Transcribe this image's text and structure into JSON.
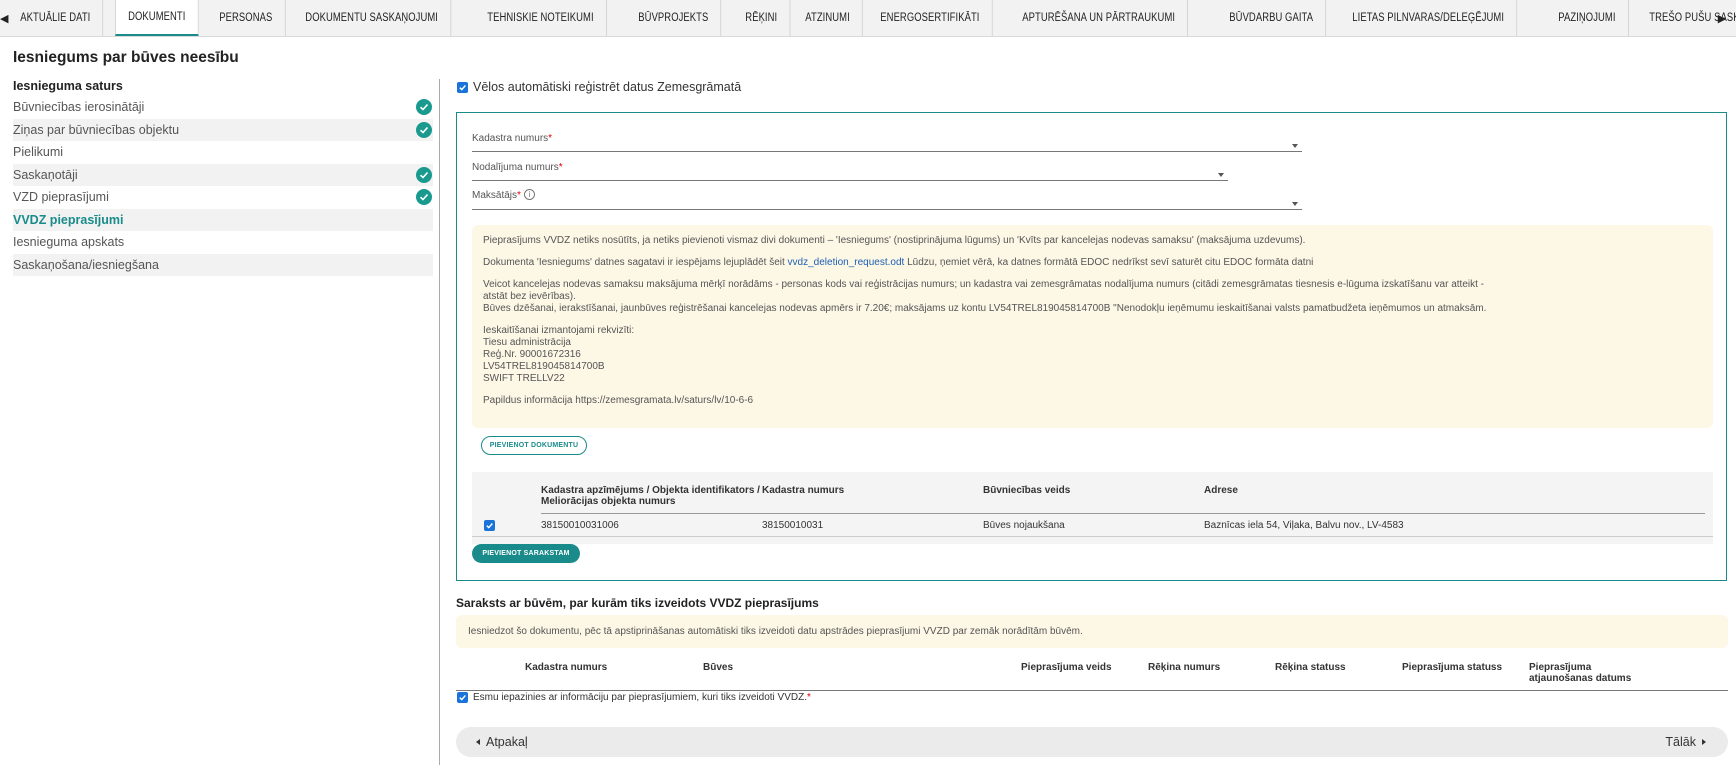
{
  "tabs": {
    "left_arrow": "◀",
    "right_arrow": "▶",
    "items": [
      "AKTUĀLIE DATI",
      "DOKUMENTI",
      "PERSONAS",
      "DOKUMENTU SASKAŅOJUMI",
      "TEHNISKIE NOTEIKUMI",
      "BŪVPROJEKTS",
      "RĒĶINI",
      "ATZINUMI",
      "ENERGOSERTIFIKĀTI",
      "APTURĒŠANA UN PĀRTRAUKUMI",
      "BŪVDARBU GAITA",
      "LIETAS PILNVARAS/DELEĢĒJUMI",
      "PAZIŅOJUMI",
      "TREŠO PUŠU SASKAŅOJUMI"
    ],
    "active_index": 1
  },
  "page_title": "Iesniegums par būves neesību",
  "leftnav": {
    "heading": "Iesnieguma saturs",
    "items": [
      {
        "label": "Būvniecības ierosinātāji",
        "completed": true
      },
      {
        "label": "Ziņas par būvniecības objektu",
        "completed": true
      },
      {
        "label": "Pielikumi",
        "completed": false
      },
      {
        "label": "Saskaņotāji",
        "completed": true
      },
      {
        "label": "VZD pieprasījumi",
        "completed": true
      },
      {
        "label": "VVDZ pieprasījumi",
        "completed": false
      },
      {
        "label": "Iesnieguma apskats",
        "completed": false
      },
      {
        "label": "Saskaņošana/iesniegšana",
        "completed": false
      }
    ]
  },
  "auto_register": {
    "label": "Vēlos automātiski reģistrēt datus Zemesgrāmatā",
    "checked": true
  },
  "form": {
    "cadastre_number_label": "Kadastra numurs",
    "division_number_label": "Nodalījuma numurs",
    "payer_label": "Maksātājs",
    "required_mark": "*",
    "info_glyph": "i"
  },
  "note": {
    "p1": "Pieprasījums VVDZ netiks nosūtīts, ja netiks pievienoti vismaz divi dokumenti – 'Iesniegums' (nostiprinājuma lūgums) un 'Kvīts par kancelejas nodevas samaksu' (maksājuma uzdevums).",
    "p2_before": "Dokumenta 'Iesniegums' datnes sagatavi ir iespējams lejuplādēt šeit ",
    "p2_link": "vvdz_deletion_request.odt",
    "p2_after": " Lūdzu, ņemiet vērā, ka datnes formātā EDOC nedrīkst sevī saturēt citu EDOC formāta datni",
    "p3_line1": "Veicot kancelejas nodevas samaksu maksājuma mērķī norādāms - personas kods vai reģistrācijas numurs; un kadastra vai zemesgrāmatas nodalījuma numurs (citādi zemesgrāmatas tiesnesis e-lūguma izskatīšanu var atteikt -",
    "p3_line2": "atstāt bez ievērības).",
    "p3_line3": "Būves dzēšanai, ierakstīšanai, jaunbūves reģistrēšanai kancelejas nodevas apmērs ir 7.20€; maksājams uz kontu LV54TREL819045814700B \"Nenodokļu ieņēmumu ieskaitīšanai valsts pamatbudžeta ieņēmumos un atmaksām.",
    "p4_title": "Ieskaitīšanai izmantojami rekvizīti:",
    "p4_lines": [
      "Tiesu administrācija",
      "Reģ.Nr. 90001672316",
      "LV54TREL819045814700B",
      "SWIFT TRELLV22"
    ],
    "p5": "Papildus informācija https://zemesgramata.lv/saturs/lv/10-6-6"
  },
  "add_document_button": "PIEVIENOT DOKUMENTU",
  "objects_table": {
    "headers": {
      "identifier_line1": "Kadastra apzīmējums / Objekta identifikators /",
      "identifier_line2": "Meliorācijas objekta numurs",
      "cadastre_number": "Kadastra numurs",
      "construction_type": "Būvniecības veids",
      "address": "Adrese"
    },
    "rows": [
      {
        "checked": true,
        "identifier": "38150010031006",
        "cadastre_number": "38150010031",
        "construction_type": "Būves nojaukšana",
        "address": "Baznīcas iela 54, Viļaka, Balvu nov., LV-4583"
      }
    ]
  },
  "add_to_list_button": "PIEVIENOT SARAKSTAM",
  "buildings_section": {
    "title": "Saraksts ar būvēm, par kurām tiks izveidots VVDZ pieprasījums",
    "info": "Iesniedzot šo dokumentu, pēc tā apstiprināšanas automātiski tiks izveidoti datu apstrādes pieprasījumi VVZD par zemāk norādītām būvēm.",
    "headers": {
      "cadastre_number": "Kadastra numurs",
      "buildings": "Būves",
      "request_type": "Pieprasījuma veids",
      "invoice_number": "Rēķina numurs",
      "invoice_status": "Rēķina statuss",
      "request_status": "Pieprasījuma statuss",
      "updated_line1": "Pieprasījuma",
      "updated_line2": "atjaunošanas datums"
    }
  },
  "acknowledgement": {
    "label": "Esmu iepazinies ar informāciju par pieprasījumiem, kuri tiks izveidoti VVDZ.",
    "required_mark": "*",
    "checked": true
  },
  "footer": {
    "back": "Atpakaļ",
    "next": "Tālāk"
  },
  "colors": {
    "accent": "#1a8b8b",
    "check_green": "#1a9a8e",
    "checkbox_blue": "#1a73d9",
    "note_bg": "#fdf7e6",
    "required": "#dd0000"
  }
}
